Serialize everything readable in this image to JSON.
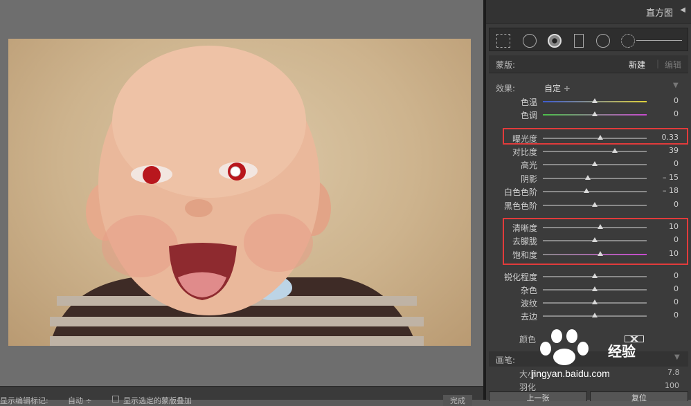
{
  "histogram": {
    "title": "直方图"
  },
  "mask": {
    "label": "蒙版:",
    "new_label": "新建",
    "edit_label": "编辑"
  },
  "effect": {
    "label": "效果:",
    "value": "自定 ÷"
  },
  "sliders": [
    {
      "name": "temp",
      "label": "色温",
      "value": "0",
      "pos": 0.5,
      "track": "linear-gradient(90deg,#3d5bd0,#e0d23a)"
    },
    {
      "name": "tint",
      "label": "色调",
      "value": "0",
      "pos": 0.5,
      "track": "linear-gradient(90deg,#4cc04a,#c84ad0)"
    },
    {
      "name": "exposure",
      "label": "曝光度",
      "value": "0.33",
      "pos": 0.55,
      "track": "#8a8a8a"
    },
    {
      "name": "contrast",
      "label": "对比度",
      "value": "39",
      "pos": 0.69,
      "track": "#8a8a8a"
    },
    {
      "name": "highlights",
      "label": "高光",
      "value": "0",
      "pos": 0.5,
      "track": "#8a8a8a"
    },
    {
      "name": "shadows",
      "label": "阴影",
      "value": "– 15",
      "pos": 0.43,
      "track": "#8a8a8a"
    },
    {
      "name": "whites",
      "label": "白色色阶",
      "value": "– 18",
      "pos": 0.42,
      "track": "#8a8a8a"
    },
    {
      "name": "blacks",
      "label": "黑色色阶",
      "value": "0",
      "pos": 0.5,
      "track": "#8a8a8a"
    },
    {
      "name": "clarity",
      "label": "清晰度",
      "value": "10",
      "pos": 0.55,
      "track": "#8a8a8a"
    },
    {
      "name": "dehaze",
      "label": "去朦胧",
      "value": "0",
      "pos": 0.5,
      "track": "#8a8a8a"
    },
    {
      "name": "saturation",
      "label": "饱和度",
      "value": "10",
      "pos": 0.55,
      "track": "linear-gradient(90deg,#888,#c84ad0)"
    },
    {
      "name": "sharpness",
      "label": "锐化程度",
      "value": "0",
      "pos": 0.5,
      "track": "#8a8a8a"
    },
    {
      "name": "noise",
      "label": "杂色",
      "value": "0",
      "pos": 0.5,
      "track": "#8a8a8a"
    },
    {
      "name": "moire",
      "label": "波纹",
      "value": "0",
      "pos": 0.5,
      "track": "#8a8a8a"
    },
    {
      "name": "defringe",
      "label": "去边",
      "value": "0",
      "pos": 0.5,
      "track": "#8a8a8a"
    }
  ],
  "color": {
    "label": "颜色"
  },
  "brush": {
    "label": "画笔:",
    "size_label": "大小",
    "size_value": "7.8",
    "feather_label": "羽化",
    "feather_value": "100"
  },
  "nav": {
    "prev_label": "上一张",
    "reset_label": "复位"
  },
  "bottombar": {
    "show_pins": "显示编辑标记:",
    "auto": "自动 ÷",
    "show_overlay": "显示选定的蒙版叠加",
    "done": "完成"
  },
  "watermark": {
    "text": "经验",
    "url": "jingyan.baidu.com"
  },
  "colors": {
    "highlight": "#e23b3b",
    "panel": "#3b3b3b"
  }
}
